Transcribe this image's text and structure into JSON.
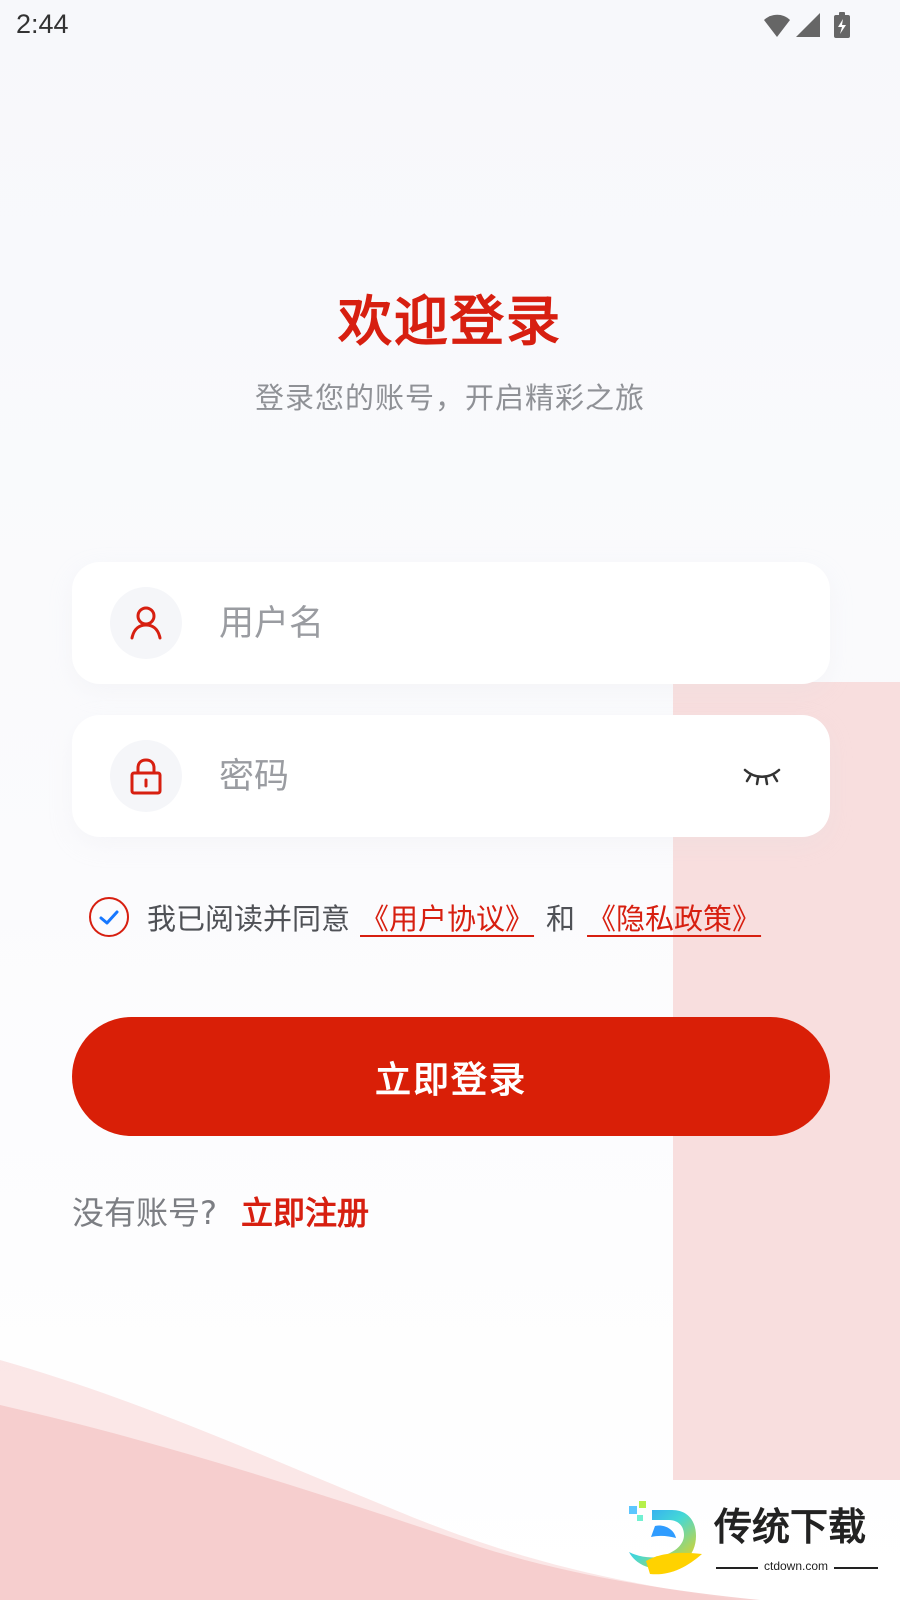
{
  "status_bar": {
    "time": "2:44"
  },
  "icons": {
    "wifi": "wifi-icon",
    "signal": "signal-icon",
    "battery": "battery-icon",
    "user": "user-icon",
    "lock": "lock-icon",
    "eye_closed": "eye-closed-icon",
    "check": "check-icon"
  },
  "welcome": {
    "title": "欢迎登录",
    "subtitle": "登录您的账号，开启精彩之旅"
  },
  "form": {
    "username": {
      "value": "",
      "placeholder": "用户名"
    },
    "password": {
      "value": "",
      "placeholder": "密码"
    },
    "agreement": {
      "checked": true,
      "prefix": "我已阅读并同意",
      "user_agreement": "《用户协议》",
      "and": "和",
      "privacy_policy": "《隐私政策》"
    },
    "login_button": "立即登录",
    "register_prompt": "没有账号?",
    "register_link": "立即注册"
  },
  "watermark": {
    "title": "传统下载",
    "url": "ctdown.com"
  },
  "colors": {
    "primary": "#D71F10",
    "button": "#D91F07",
    "background": "#F6F7FA",
    "panel_pink": "#F8DEDE",
    "placeholder": "#9A9CA1"
  }
}
